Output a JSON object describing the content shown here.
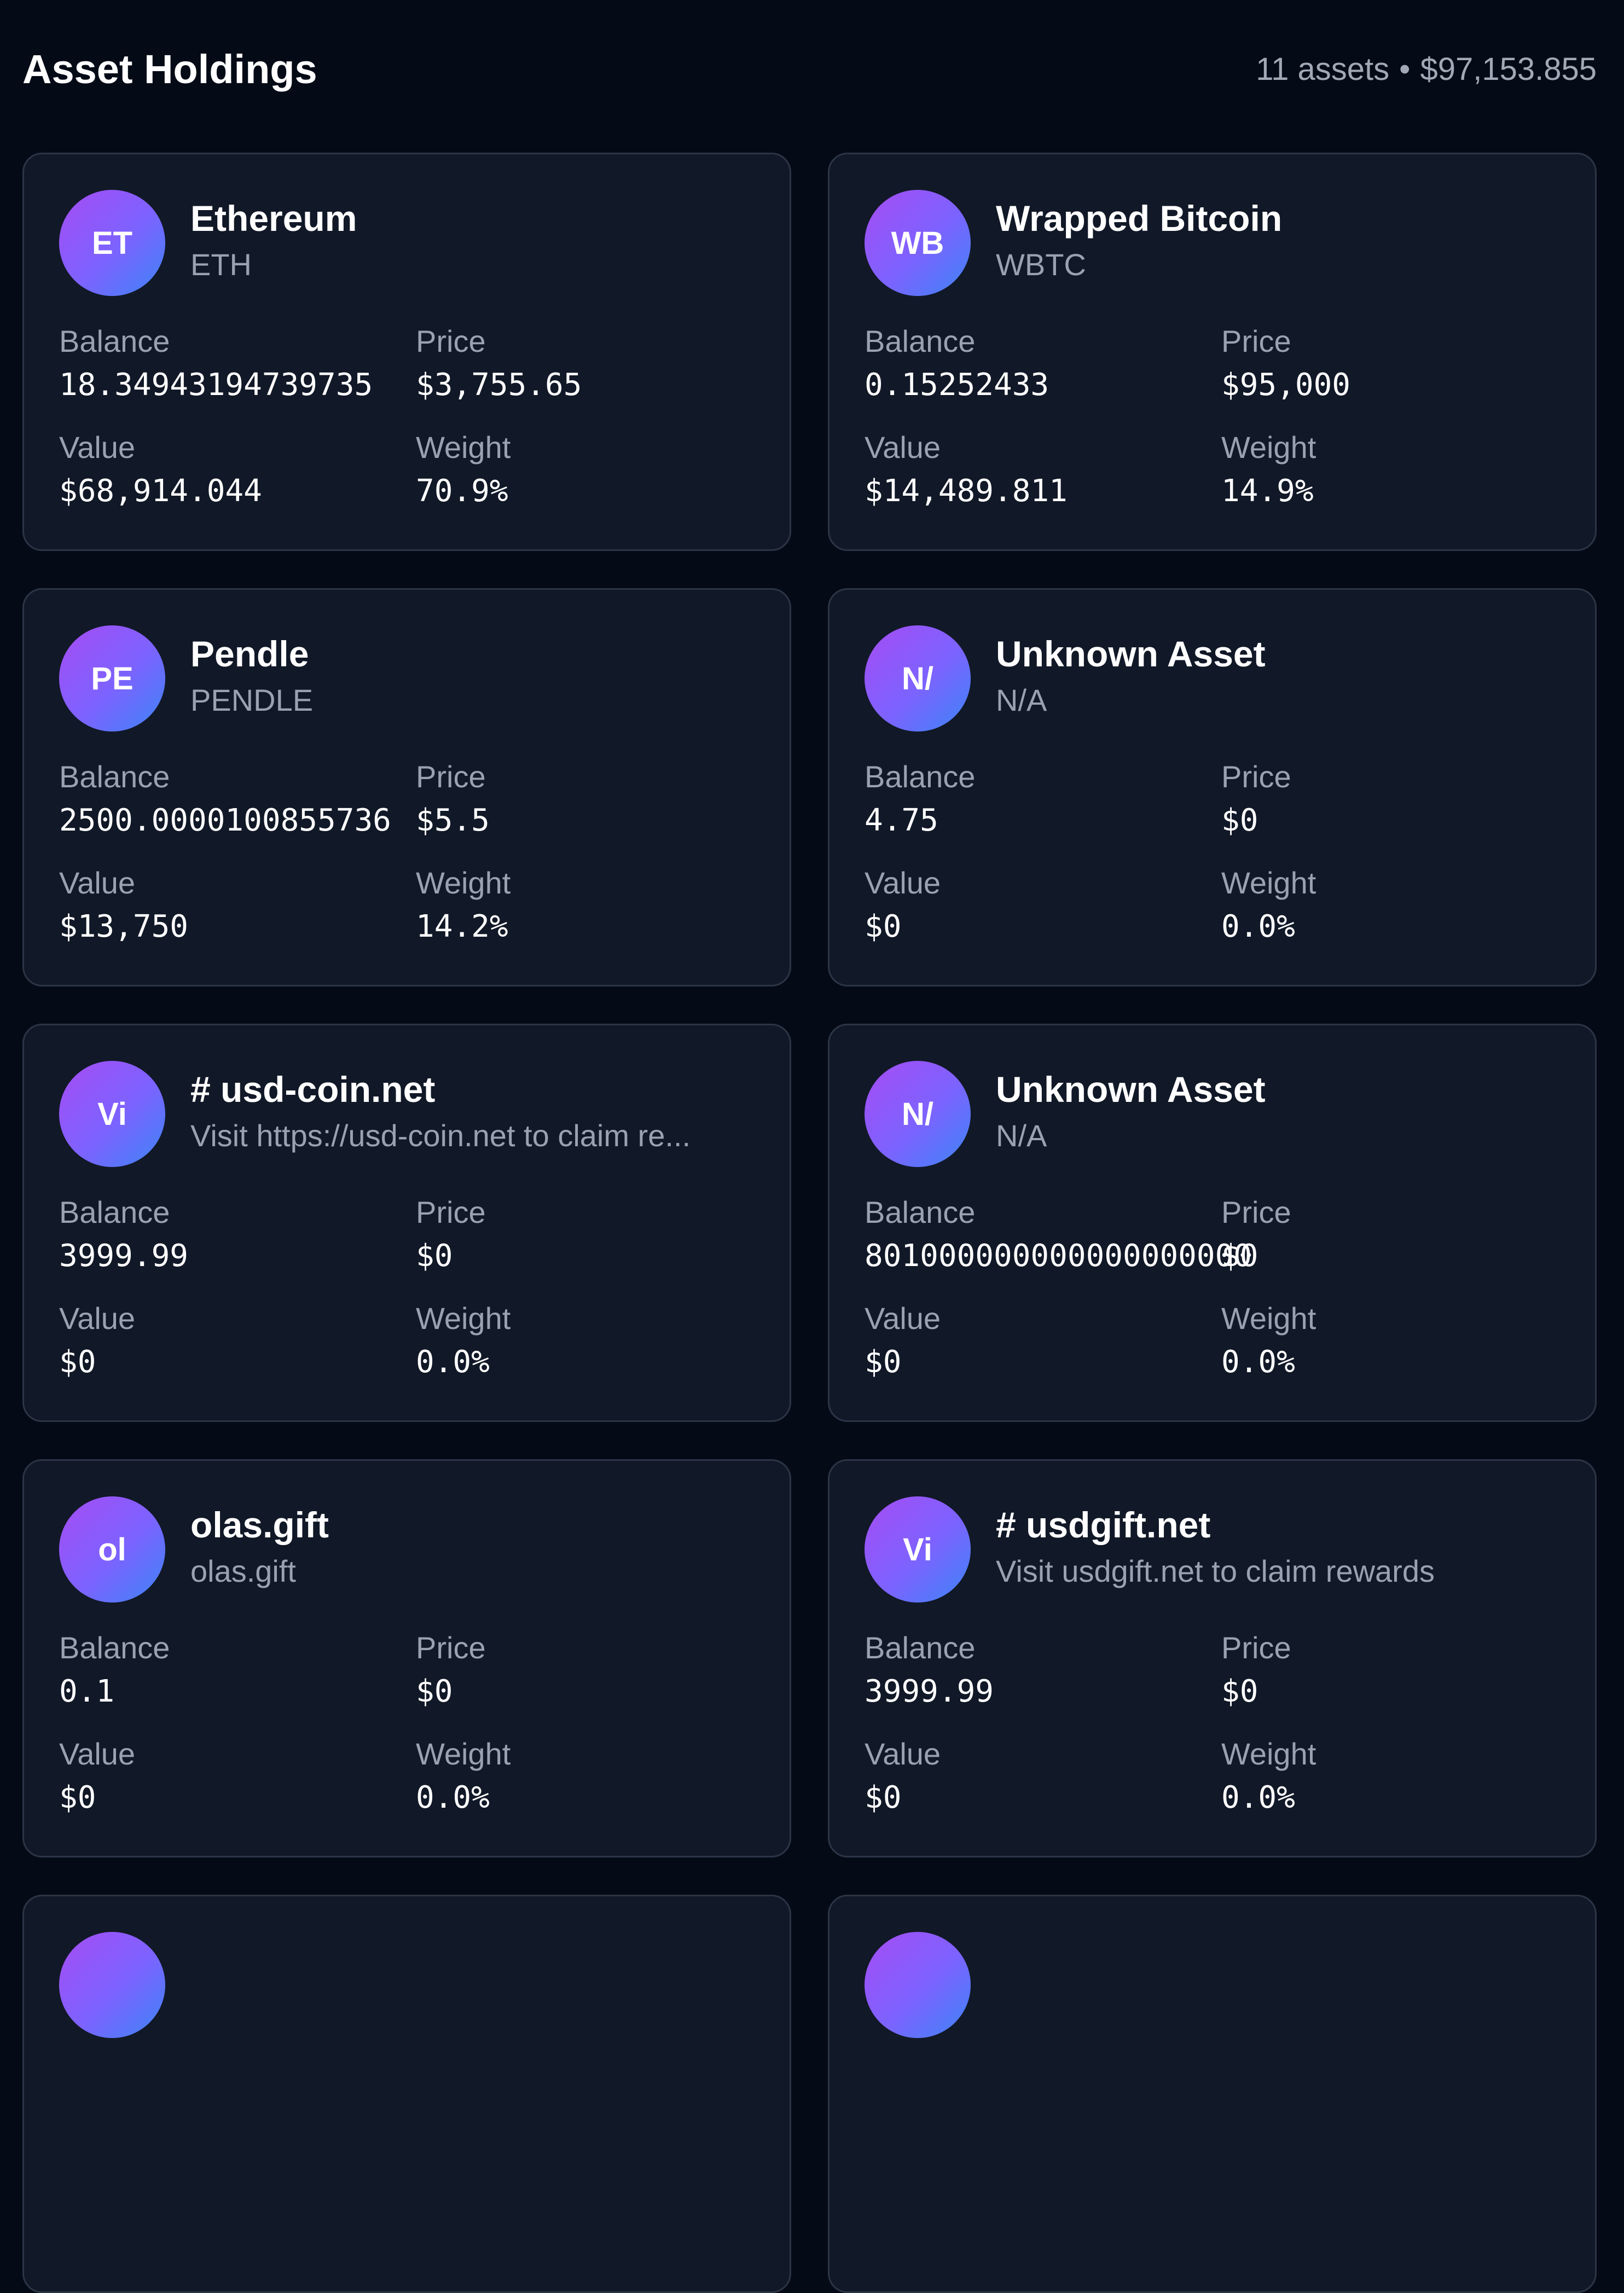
{
  "header": {
    "title": "Asset Holdings",
    "asset_count": "11 assets",
    "separator": "•",
    "total_value": "$97,153.855"
  },
  "labels": {
    "balance": "Balance",
    "price": "Price",
    "value": "Value",
    "weight": "Weight"
  },
  "assets": [
    {
      "initials": "ET",
      "name": "Ethereum",
      "symbol": "ETH",
      "balance": "18.34943194739735",
      "price": "$3,755.65",
      "value": "$68,914.044",
      "weight": "70.9%"
    },
    {
      "initials": "WB",
      "name": "Wrapped Bitcoin",
      "symbol": "WBTC",
      "balance": "0.15252433",
      "price": "$95,000",
      "value": "$14,489.811",
      "weight": "14.9%"
    },
    {
      "initials": "PE",
      "name": "Pendle",
      "symbol": "PENDLE",
      "balance": "2500.0000100855736",
      "price": "$5.5",
      "value": "$13,750",
      "weight": "14.2%"
    },
    {
      "initials": "N/",
      "name": "Unknown Asset",
      "symbol": "N/A",
      "balance": "4.75",
      "price": "$0",
      "value": "$0",
      "weight": "0.0%"
    },
    {
      "initials": "Vi",
      "name": "# usd-coin.net",
      "symbol": "Visit https://usd-coin.net to claim re...",
      "balance": "3999.99",
      "price": "$0",
      "value": "$0",
      "weight": "0.0%"
    },
    {
      "initials": "N/",
      "name": "Unknown Asset",
      "symbol": "N/A",
      "balance": "801000000000000000000",
      "price": "$0",
      "value": "$0",
      "weight": "0.0%"
    },
    {
      "initials": "ol",
      "name": "olas.gift",
      "symbol": "olas.gift",
      "balance": "0.1",
      "price": "$0",
      "value": "$0",
      "weight": "0.0%"
    },
    {
      "initials": "Vi",
      "name": "# usdgift.net",
      "symbol": "Visit usdgift.net to claim rewards",
      "balance": "3999.99",
      "price": "$0",
      "value": "$0",
      "weight": "0.0%"
    },
    {
      "initials": "",
      "name": "",
      "symbol": "",
      "balance": "",
      "price": "",
      "value": "",
      "weight": ""
    },
    {
      "initials": "",
      "name": "",
      "symbol": "",
      "balance": "",
      "price": "",
      "value": "",
      "weight": ""
    }
  ]
}
